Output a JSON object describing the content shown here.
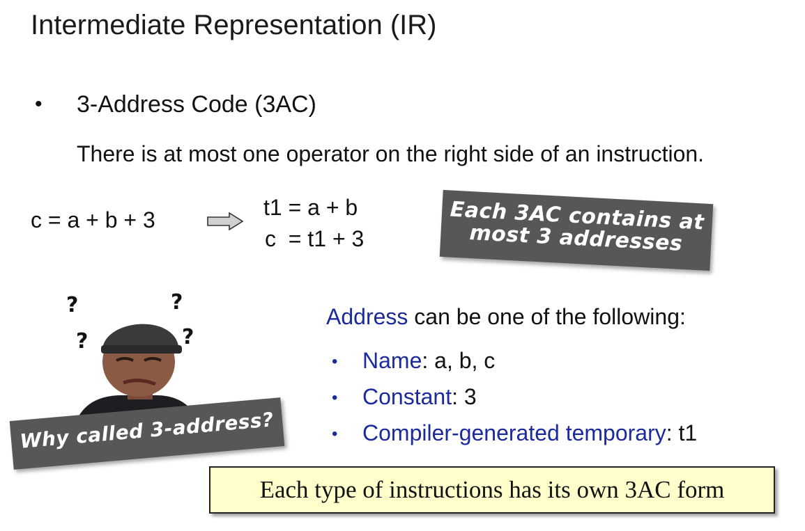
{
  "slide": {
    "title": "Intermediate Representation (IR)",
    "bullet_symbol": "•",
    "subtitle": "3-Address Code (3AC)",
    "description": "There is at most one operator on the right side of an instruction."
  },
  "example": {
    "original": "c = a + b + 3",
    "arrow_icon": "right-arrow-icon",
    "translated": [
      "t1 = a + b",
      "c  = t1 + 3"
    ]
  },
  "callouts": {
    "contains_note": "Each 3AC contains at most 3 addresses",
    "question": "Why called 3-address?"
  },
  "meme": {
    "question_marks": [
      "?",
      "?",
      "?",
      "?"
    ]
  },
  "address_section": {
    "heading_term": "Address",
    "heading_rest": " can be one of the following:",
    "items": [
      {
        "term": "Name",
        "value": ": a, b, c"
      },
      {
        "term": "Constant",
        "value": ": 3"
      },
      {
        "term": "Compiler-generated temporary",
        "value": ": t1"
      }
    ],
    "bullet_symbol": "•"
  },
  "footer": {
    "text": "Each type of instructions has its own 3AC form"
  },
  "colors": {
    "accent_blue": "#1b2a9c",
    "callout_gray": "#575757",
    "footer_background": "#ffffcc"
  }
}
